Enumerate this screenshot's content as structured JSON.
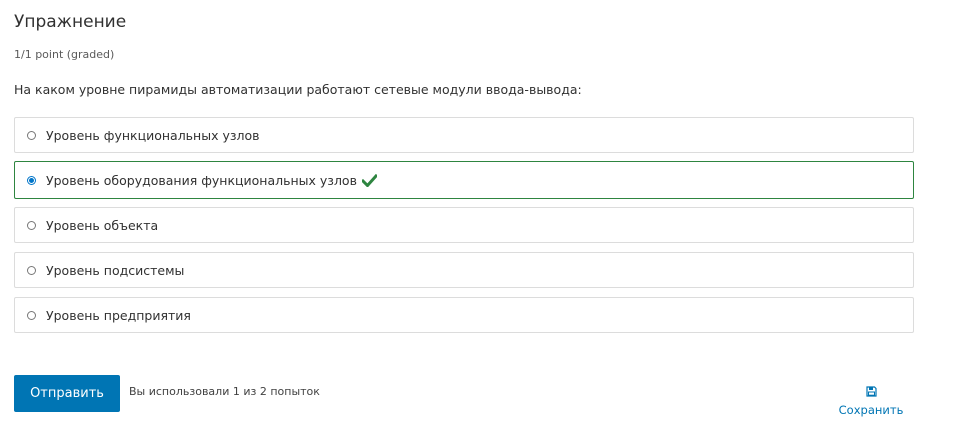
{
  "problem": {
    "title": "Упражнение",
    "points": "1/1 point (graded)",
    "question": "На каком уровне пирамиды автоматизации работают сетевые модули ввода-вывода:",
    "options": [
      {
        "label": "Уровень функциональных узлов",
        "selected": false
      },
      {
        "label": "Уровень оборудования функциональных узлов",
        "selected": true,
        "correct": true
      },
      {
        "label": "Уровень объекта",
        "selected": false
      },
      {
        "label": "Уровень подсистемы",
        "selected": false
      },
      {
        "label": "Уровень предприятия",
        "selected": false
      }
    ],
    "correct_icon": "checkmark-icon",
    "correct_color": "#2e8540"
  },
  "actions": {
    "submit_label": "Отправить",
    "attempts_text": "Вы использовали 1 из 2 попыток",
    "save_label": "Сохранить",
    "save_icon": "floppy-disk-icon",
    "accent_color": "#0075b4"
  }
}
